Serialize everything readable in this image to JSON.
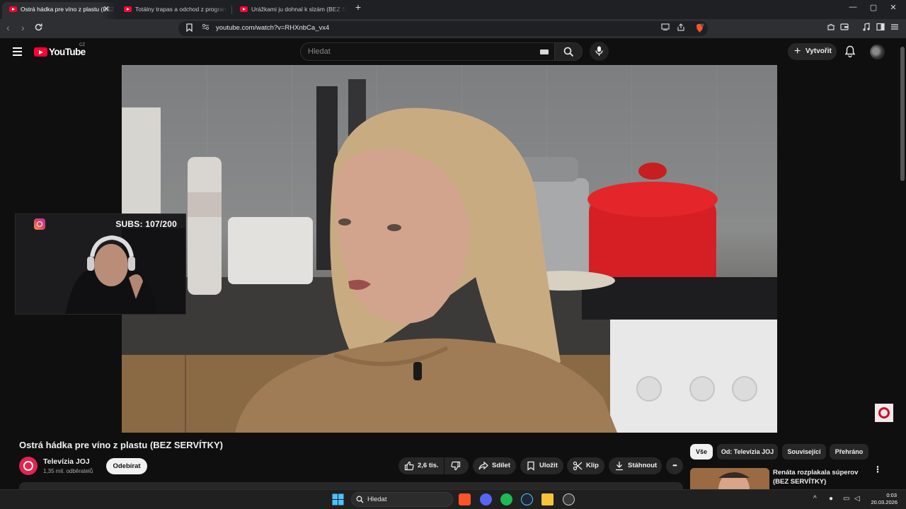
{
  "browser": {
    "tabs": [
      {
        "label": "Ostrá hádka pre víno z plastu (BEZ",
        "active": true
      },
      {
        "label": "Totálny trapas a odchod z programu",
        "active": false
      },
      {
        "label": "Urážkami ju dohnal k slzám (BEZ SER",
        "active": false
      }
    ],
    "new_tab_icon": "plus-icon",
    "window_controls": {
      "minimize": "—",
      "maximize": "▢",
      "close": "✕"
    },
    "tab_close": "✕",
    "url": "youtube.com/watch?v=RHXnbCa_vx4"
  },
  "youtube": {
    "logo_text": "YouTube",
    "country_code": "CZ",
    "search_placeholder": "Hledat",
    "create_label": "Vytvořit"
  },
  "video": {
    "title": "Ostrá hádka pre víno z plastu (BEZ SERVÍTKY)",
    "overlay_subs": "SUBS: 107/200"
  },
  "channel": {
    "name": "Televízia JOJ",
    "subscribers": "1,35 mil. odběratelů",
    "subscribe_label": "Odebírat"
  },
  "actions": {
    "likes": "2,6 tis.",
    "share": "Sdílet",
    "save": "Uložit",
    "clip": "Klip",
    "download": "Stáhnout",
    "more": "•••"
  },
  "chips": [
    {
      "label": "Vše",
      "selected": true
    },
    {
      "label": "Od: Televízia JOJ",
      "selected": false
    },
    {
      "label": "Související",
      "selected": false
    },
    {
      "label": "Přehráno",
      "selected": false
    }
  ],
  "recommended": {
    "title": "Renáta rozplakala súperov (BEZ SERVÍTKY)",
    "menu": "⋮"
  },
  "taskbar": {
    "search_label": "Hledat",
    "time": "0:03",
    "date": "20.03.2026"
  },
  "colors": {
    "youtube_red": "#ff0033",
    "background": "#0f0f0f",
    "joj_brand": "#e5234f"
  }
}
